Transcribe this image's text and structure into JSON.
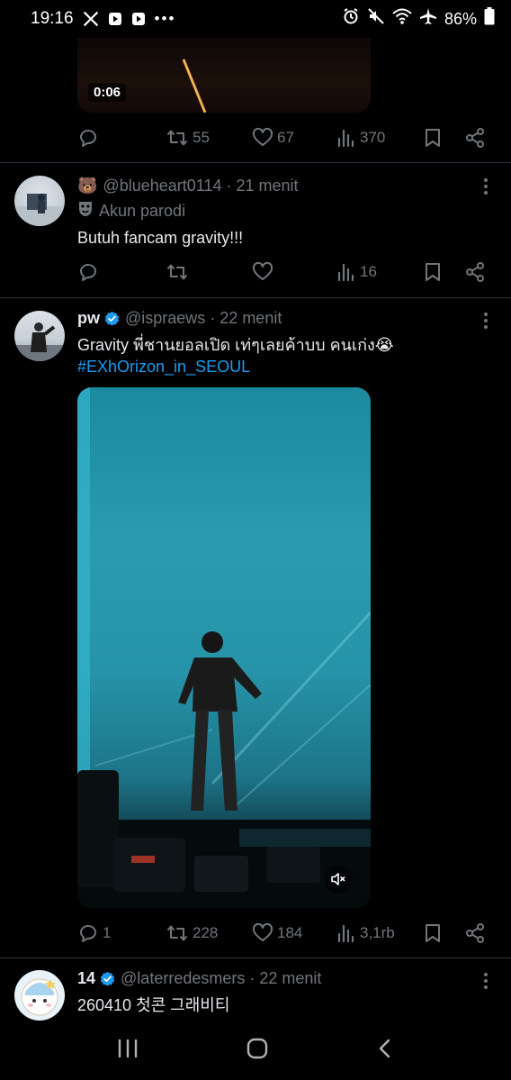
{
  "status_bar": {
    "time": "19:16",
    "battery": "86%"
  },
  "tweet1": {
    "video_time": "0:06",
    "actions": {
      "reply": "",
      "retweet": "55",
      "like": "67",
      "views": "370"
    }
  },
  "tweet2": {
    "emoji": "🐻",
    "handle": "@blueheart0114",
    "time": "· 21 menit",
    "parody_label": "Akun parodi",
    "text": "Butuh fancam gravity!!!",
    "actions": {
      "reply": "",
      "retweet": "",
      "like": "",
      "views": "16"
    }
  },
  "tweet3": {
    "name": "pw",
    "handle": "@ispraews",
    "time": "· 22 menit",
    "text": "Gravity พี่ชานยอลเปิด เท่ๆเลยค้าบบ คนเก่ง😭",
    "hashtag": "#EXhOrizon_in_SEOUL",
    "actions": {
      "reply": "1",
      "retweet": "228",
      "like": "184",
      "views": "3,1rb"
    }
  },
  "tweet4": {
    "name": "14",
    "handle": "@laterredesmers",
    "time": "· 22 menit",
    "text": "260410 첫콘 그래비티"
  },
  "colors": {
    "background": "#000000",
    "text": "#e7e9ea",
    "muted": "#71767b",
    "accent": "#1d9bf0",
    "divider": "#2f3336"
  }
}
